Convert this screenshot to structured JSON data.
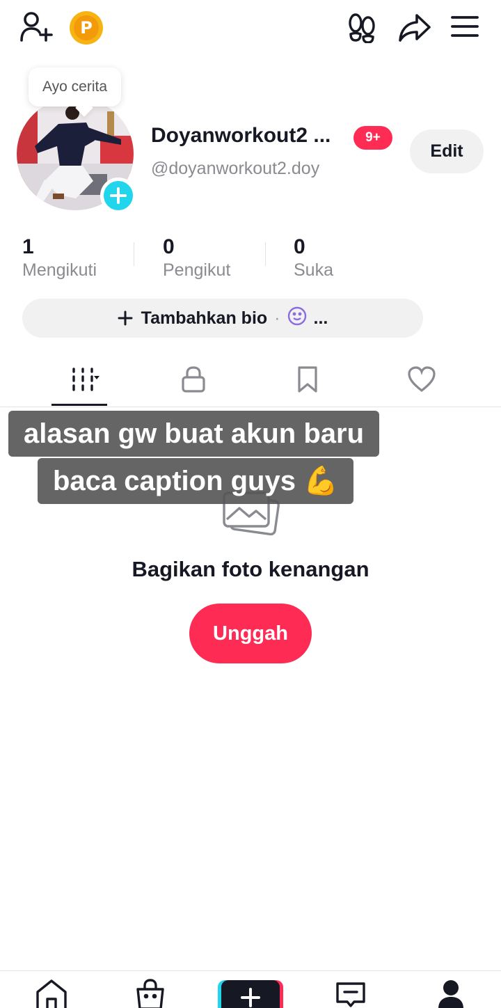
{
  "top_bar": {
    "icons": [
      "add-friend-icon",
      "coin-icon",
      "footprint-icon",
      "share-icon",
      "menu-icon"
    ],
    "coin_letter": "P"
  },
  "story": {
    "bubble_text": "Ayo cerita"
  },
  "profile": {
    "display_name": "Doyanworkout2 ...",
    "notification_badge": "9+",
    "handle": "@doyanworkout2.doy",
    "edit_label": "Edit"
  },
  "stats": [
    {
      "value": "1",
      "label": "Mengikuti"
    },
    {
      "value": "0",
      "label": "Pengikut"
    },
    {
      "value": "0",
      "label": "Suka"
    }
  ],
  "bio": {
    "label": "Tambahkan bio",
    "separator": "·",
    "more": "..."
  },
  "tabs": [
    {
      "name": "videos-grid",
      "icon": "grid-icon",
      "active": true
    },
    {
      "name": "private",
      "icon": "lock-icon"
    },
    {
      "name": "saved",
      "icon": "bookmark-icon"
    },
    {
      "name": "liked",
      "icon": "heart-icon"
    }
  ],
  "overlay_caption": {
    "line1": "alasan gw buat akun baru",
    "line2": "baca caption guys 💪"
  },
  "empty_state": {
    "icon": "photo-stack-icon",
    "title": "Bagikan foto kenangan",
    "button_label": "Unggah"
  },
  "bottom_nav": {
    "items": [
      "home-icon",
      "shop-icon",
      "create-icon",
      "inbox-icon",
      "profile-icon"
    ]
  },
  "colors": {
    "primary_red": "#fe2c55",
    "cyan": "#20d5ec",
    "text_dark": "#161823",
    "text_gray": "#8a8b91",
    "chip_bg": "#f1f1f2",
    "coin": "#f6b311"
  }
}
